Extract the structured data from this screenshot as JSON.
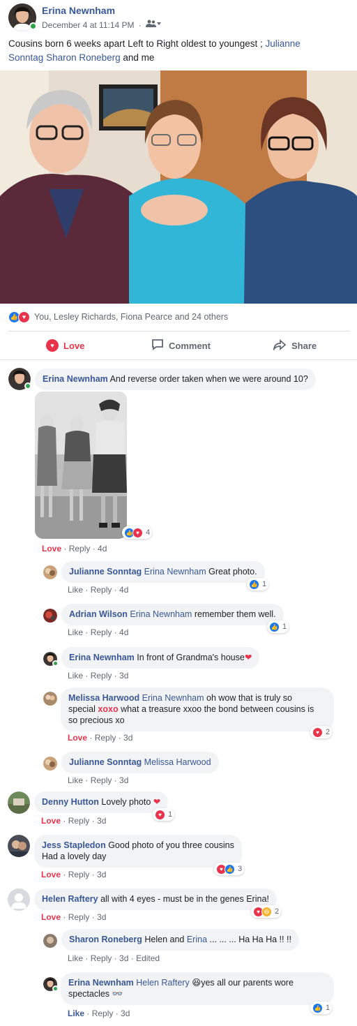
{
  "post": {
    "author": "Erina Newnham",
    "date": "December 4 at 11:14 PM",
    "audience_icon": "friends-icon",
    "text_prefix": "Cousins born 6 weeks apart Left to Right oldest to youngest ;",
    "tag_1": "Julianne",
    "tag_1_cont": "Sonntag",
    "tag_2": "Sharon Roneberg",
    "text_suffix": "and me"
  },
  "reactions": {
    "summary": "You, Lesley Richards, Fiona Pearce and 24 others",
    "icons": [
      "like-icon",
      "love-icon"
    ]
  },
  "actions": {
    "love": "Love",
    "comment": "Comment",
    "share": "Share"
  },
  "comments": [
    {
      "author": "Erina Newnham",
      "text": "And reverse order taken when we were around 10?",
      "liked": "Love",
      "reply": "Reply",
      "time": "4d",
      "reaction_count": "4"
    },
    {
      "author": "Julianne Sonntag",
      "mention": "Erina Newnham",
      "text": "Great photo.",
      "liked": "Like",
      "reply": "Reply",
      "time": "4d",
      "reaction_count": "1"
    },
    {
      "author": "Adrian Wilson",
      "mention": "Erina Newnham",
      "text": "remember them well.",
      "liked": "Like",
      "reply": "Reply",
      "time": "4d",
      "reaction_count": "1"
    },
    {
      "author": "Erina Newnham",
      "text": "In front of Grandma's house",
      "emoji": "❤",
      "liked": "Like",
      "reply": "Reply",
      "time": "3d"
    },
    {
      "author": "Melissa Harwood",
      "mention": "Erina Newnham",
      "text_a": "oh wow that is truly so",
      "text_b": "special",
      "highlight": "xoxo",
      "text_c": "what a treasure xxoo the bond between cousins is",
      "text_d": "so precious xo",
      "liked": "Love",
      "reply": "Reply",
      "time": "3d",
      "reaction_count": "2"
    },
    {
      "author": "Julianne Sonntag",
      "mention": "Melissa Harwood",
      "liked": "Like",
      "reply": "Reply",
      "time": "3d"
    },
    {
      "author": "Denny Hutton",
      "text": "Lovely photo",
      "emoji": "❤",
      "liked": "Love",
      "reply": "Reply",
      "time": "3d",
      "reaction_count": "1"
    },
    {
      "author": "Jess Stapledon",
      "text": "Good photo of you three cousins",
      "text_2": "Had a lovely day",
      "liked": "Love",
      "reply": "Reply",
      "time": "3d",
      "reaction_count": "3"
    },
    {
      "author": "Helen Raftery",
      "text": "all with 4 eyes - must be in the genes Erina!",
      "liked": "Love",
      "reply": "Reply",
      "time": "3d",
      "reaction_count": "2"
    },
    {
      "author": "Sharon Roneberg",
      "text_a": "Helen and",
      "mention": "Erina",
      "text_b": "... ... ... Ha Ha Ha !! !!",
      "liked": "Like",
      "reply": "Reply",
      "time": "3d",
      "edited": "Edited"
    },
    {
      "author": "Erina Newnham",
      "mention": "Helen Raftery",
      "emoji": "😆",
      "text": "yes all our parents wore",
      "text_2": "spectacles",
      "emoji_2": "👓",
      "liked": "Like",
      "reply": "Reply",
      "time": "3d",
      "reaction_count": "1"
    }
  ],
  "colors": {
    "link": "#385898",
    "love": "#e8334a",
    "like": "#1877f2",
    "bubble": "#f2f3f5",
    "meta": "#606770"
  }
}
